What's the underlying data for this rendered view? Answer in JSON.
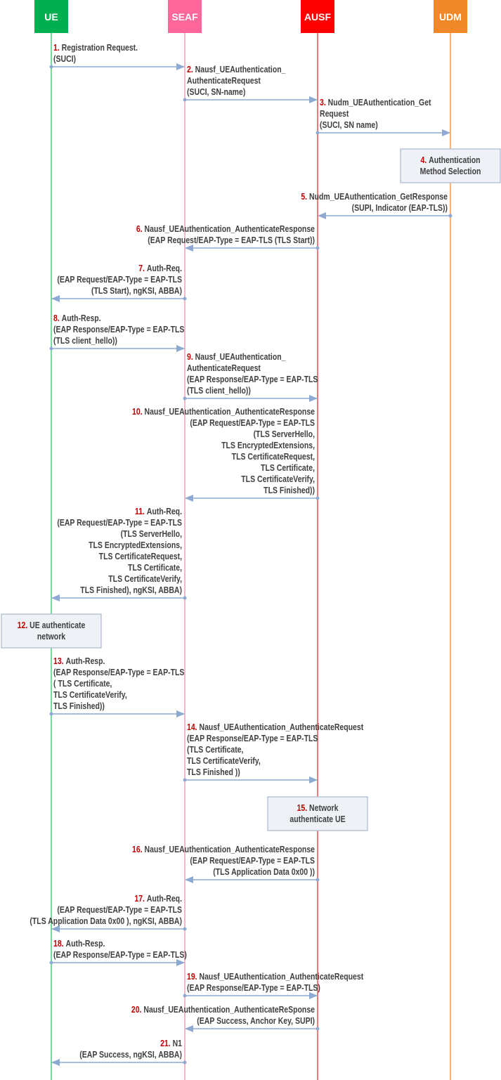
{
  "participants": [
    {
      "id": "UE",
      "label": "UE",
      "color": "#00b050",
      "line_color": "#7fd4a0"
    },
    {
      "id": "SEAF",
      "label": "SEAF",
      "color": "#ff6699",
      "line_color": "#ffb3cb"
    },
    {
      "id": "AUSF",
      "label": "AUSF",
      "color": "#ff0000",
      "line_color": "#f07a7a"
    },
    {
      "id": "UDM",
      "label": "UDM",
      "color": "#f0882a",
      "line_color": "#f5b47c"
    }
  ],
  "arrow_color": "#8eaad2",
  "note_fill": "#eef1f6",
  "note_border": "#a9b9d2",
  "number_color": "#c00000",
  "steps": [
    {
      "kind": "message",
      "num": "1.",
      "from": "UE",
      "to": "SEAF",
      "lines": [
        "Registration Request.",
        "(SUCI)"
      ]
    },
    {
      "kind": "message",
      "num": "2.",
      "from": "SEAF",
      "to": "AUSF",
      "lines": [
        "Nausf_UEAuthentication_",
        "AuthenticateRequest",
        "(SUCI, SN-name)"
      ]
    },
    {
      "kind": "message",
      "num": "3.",
      "from": "AUSF",
      "to": "UDM",
      "lines": [
        "Nudm_UEAuthentication_Get",
        "Request",
        "(SUCI, SN name)"
      ]
    },
    {
      "kind": "note",
      "num": "4.",
      "over": "UDM",
      "lines": [
        "Authentication",
        "Method Selection"
      ]
    },
    {
      "kind": "message",
      "num": "5.",
      "from": "UDM",
      "to": "AUSF",
      "lines": [
        "Nudm_UEAuthentication_GetResponse",
        "(SUPI, Indicator (EAP-TLS))"
      ]
    },
    {
      "kind": "message",
      "num": "6.",
      "from": "AUSF",
      "to": "SEAF",
      "lines": [
        "Nausf_UEAuthentication_AuthenticateResponse",
        "(EAP Request/EAP-Type = EAP-TLS (TLS Start))"
      ]
    },
    {
      "kind": "message",
      "num": "7.",
      "from": "SEAF",
      "to": "UE",
      "lines": [
        "Auth-Req.",
        "(EAP Request/EAP-Type = EAP-TLS",
        "(TLS Start), ngKSI, ABBA)"
      ]
    },
    {
      "kind": "message",
      "num": "8.",
      "from": "UE",
      "to": "SEAF",
      "lines": [
        "Auth-Resp.",
        "(EAP Response/EAP-Type = EAP-TLS",
        "(TLS client_hello))"
      ]
    },
    {
      "kind": "message",
      "num": "9.",
      "from": "SEAF",
      "to": "AUSF",
      "lines": [
        "Nausf_UEAuthentication_",
        "AuthenticateRequest",
        "(EAP Response/EAP-Type = EAP-TLS",
        "(TLS client_hello))"
      ]
    },
    {
      "kind": "message",
      "num": "10.",
      "from": "AUSF",
      "to": "SEAF",
      "lines": [
        "Nausf_UEAuthentication_AuthenticateResponse",
        "(EAP Request/EAP-Type = EAP-TLS",
        "(TLS ServerHello,",
        "TLS EncryptedExtensions,",
        "TLS CertificateRequest,",
        "TLS Certificate,",
        "TLS CertificateVerify,",
        "TLS Finished))"
      ]
    },
    {
      "kind": "message",
      "num": "11.",
      "from": "SEAF",
      "to": "UE",
      "lines": [
        "Auth-Req.",
        "(EAP Request/EAP-Type = EAP-TLS",
        "(TLS ServerHello,",
        "TLS EncryptedExtensions,",
        "TLS CertificateRequest,",
        "TLS Certificate,",
        "TLS CertificateVerify,",
        "TLS Finished), ngKSI, ABBA)"
      ]
    },
    {
      "kind": "note",
      "num": "12.",
      "over": "UE",
      "lines": [
        "UE authenticate",
        "network"
      ]
    },
    {
      "kind": "message",
      "num": "13.",
      "from": "UE",
      "to": "SEAF",
      "lines": [
        "Auth-Resp.",
        "(EAP Response/EAP-Type = EAP-TLS",
        "( TLS Certificate,",
        "TLS CertificateVerify,",
        "TLS Finished))"
      ]
    },
    {
      "kind": "message",
      "num": "14.",
      "from": "SEAF",
      "to": "AUSF",
      "lines": [
        "Nausf_UEAuthentication_AuthenticateRequest",
        "(EAP Response/EAP-Type = EAP-TLS",
        "(TLS Certificate,",
        "TLS CertificateVerify,",
        "TLS Finished ))"
      ]
    },
    {
      "kind": "note",
      "num": "15.",
      "over": "AUSF",
      "lines": [
        "Network",
        "authenticate UE"
      ]
    },
    {
      "kind": "message",
      "num": "16.",
      "from": "AUSF",
      "to": "SEAF",
      "lines": [
        "Nausf_UEAuthentication_AuthenticateResponse",
        "(EAP Request/EAP-Type = EAP-TLS",
        "(TLS Application Data 0x00 ))"
      ]
    },
    {
      "kind": "message",
      "num": "17.",
      "from": "SEAF",
      "to": "UE",
      "lines": [
        "Auth-Req.",
        "(EAP Request/EAP-Type = EAP-TLS",
        "(TLS Application Data 0x00 ), ngKSI, ABBA)"
      ]
    },
    {
      "kind": "message",
      "num": "18.",
      "from": "UE",
      "to": "SEAF",
      "lines": [
        "Auth-Resp.",
        "(EAP Response/EAP-Type = EAP-TLS)"
      ]
    },
    {
      "kind": "message",
      "num": "19.",
      "from": "SEAF",
      "to": "AUSF",
      "lines": [
        "Nausf_UEAuthentication_AuthenticateRequest",
        "(EAP Response/EAP-Type = EAP-TLS)"
      ]
    },
    {
      "kind": "message",
      "num": "20.",
      "from": "AUSF",
      "to": "SEAF",
      "lines": [
        "Nausf_UEAuthentication_AuthenticateReSponse",
        "(EAP Success, Anchor Key, SUPI)"
      ]
    },
    {
      "kind": "message",
      "num": "21.",
      "from": "SEAF",
      "to": "UE",
      "lines": [
        "N1",
        "(EAP Success, ngKSI, ABBA)"
      ]
    }
  ]
}
